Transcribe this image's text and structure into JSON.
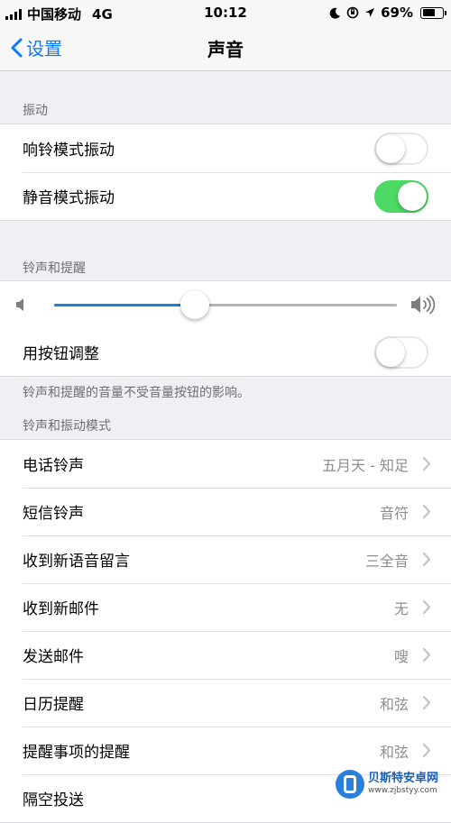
{
  "status_bar": {
    "carrier": "中国移动",
    "network": "4G",
    "time": "10:12",
    "battery": "69%",
    "battery_level": 0.69
  },
  "nav": {
    "back_label": "设置",
    "title": "声音"
  },
  "vibrate": {
    "header": "振动",
    "rows": [
      {
        "label": "响铃模式振动",
        "on": false
      },
      {
        "label": "静音模式振动",
        "on": true
      }
    ]
  },
  "ringer": {
    "header": "铃声和提醒",
    "volume_level": 0.41,
    "change_with_buttons_label": "用按钮调整",
    "change_with_buttons_on": false,
    "footer": "铃声和提醒的音量不受音量按钮的影响。"
  },
  "sounds": {
    "header": "铃声和振动模式",
    "rows": [
      {
        "label": "电话铃声",
        "value": "五月天 - 知足"
      },
      {
        "label": "短信铃声",
        "value": "音符"
      },
      {
        "label": "收到新语音留言",
        "value": "三全音"
      },
      {
        "label": "收到新邮件",
        "value": "无"
      },
      {
        "label": "发送邮件",
        "value": "嗖"
      },
      {
        "label": "日历提醒",
        "value": "和弦"
      },
      {
        "label": "提醒事项的提醒",
        "value": "和弦"
      },
      {
        "label": "隔空投送",
        "value": ""
      }
    ]
  },
  "watermark": {
    "name": "贝斯特安卓网",
    "url": "www.zjbstyy.com"
  },
  "colors": {
    "accent": "#0a7aff",
    "switch_on": "#4cd964",
    "slider_fill": "#1e7dd7"
  }
}
